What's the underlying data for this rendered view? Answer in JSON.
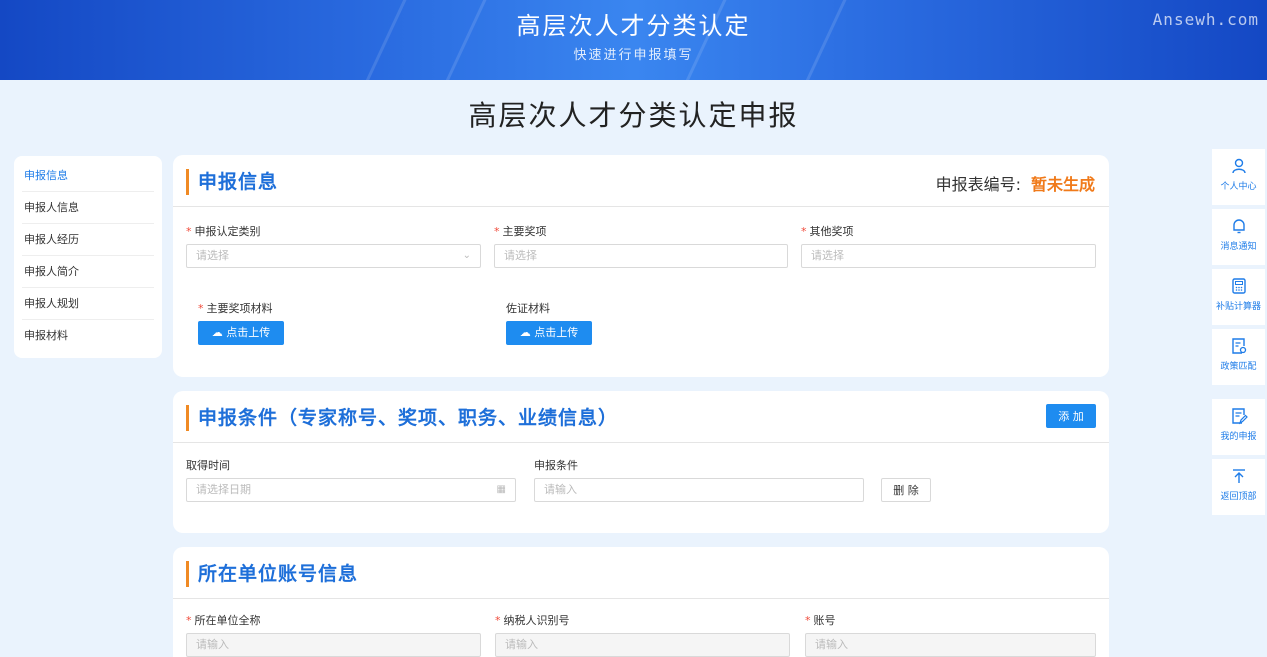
{
  "banner": {
    "title": "高层次人才分类认定",
    "subtitle": "快速进行申报填写",
    "watermark": "Ansewh.com"
  },
  "page_title": "高层次人才分类认定申报",
  "left_nav": [
    "申报信息",
    "申报人信息",
    "申报人经历",
    "申报人简介",
    "申报人规划",
    "申报材料"
  ],
  "card1": {
    "title": "申报信息",
    "serial_label": "申报表编号:",
    "serial_value": "暂未生成",
    "fields": [
      {
        "label": "申报认定类别",
        "placeholder": "请选择"
      },
      {
        "label": "主要奖项",
        "placeholder": "请选择"
      },
      {
        "label": "其他奖项",
        "placeholder": "请选择"
      }
    ],
    "uploads": [
      {
        "label": "主要奖项材料",
        "button": "点击上传"
      },
      {
        "label": "佐证材料",
        "button": "点击上传"
      }
    ]
  },
  "card2": {
    "title": "申报条件（专家称号、奖项、职务、业绩信息）",
    "add_label": "添 加",
    "time_label": "取得时间",
    "time_placeholder": "请选择日期",
    "cond_label": "申报条件",
    "cond_placeholder": "请输入",
    "delete_label": "删 除"
  },
  "card3": {
    "title": "所在单位账号信息",
    "fields": [
      {
        "label": "所在单位全称",
        "placeholder": "请输入"
      },
      {
        "label": "纳税人识别号",
        "placeholder": "请输入"
      },
      {
        "label": "账号",
        "placeholder": "请输入"
      }
    ]
  },
  "right_bar": [
    "个人中心",
    "消息通知",
    "补贴计算器",
    "政策匹配",
    "我的申报",
    "返回顶部"
  ],
  "colors": {
    "accent": "#1e8cf0",
    "title_blue": "#1e6fd9",
    "orange": "#f08a24",
    "required": "#f04a3a"
  }
}
